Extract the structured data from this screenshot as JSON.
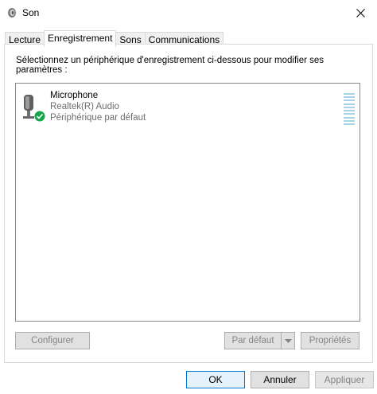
{
  "window": {
    "title": "Son",
    "close_icon": "close-icon"
  },
  "tabs": [
    {
      "label": "Lecture",
      "active": false
    },
    {
      "label": "Enregistrement",
      "active": true
    },
    {
      "label": "Sons",
      "active": false
    },
    {
      "label": "Communications",
      "active": false
    }
  ],
  "panel": {
    "instruction": "Sélectionnez un périphérique d'enregistrement ci-dessous pour modifier ses paramètres :"
  },
  "devices": [
    {
      "name": "Microphone",
      "driver": "Realtek(R) Audio",
      "status": "Périphérique par défaut",
      "icon": "microphone-icon",
      "badge": "default-check-icon",
      "level_fraction": 0
    }
  ],
  "buttons": {
    "configure": "Configurer",
    "set_default": "Par défaut",
    "properties": "Propriétés"
  },
  "footer": {
    "ok": "OK",
    "cancel": "Annuler",
    "apply": "Appliquer"
  },
  "colors": {
    "accent": "#0078d7",
    "check_badge": "#16a34a",
    "level_meter": "#a7d3e6"
  }
}
